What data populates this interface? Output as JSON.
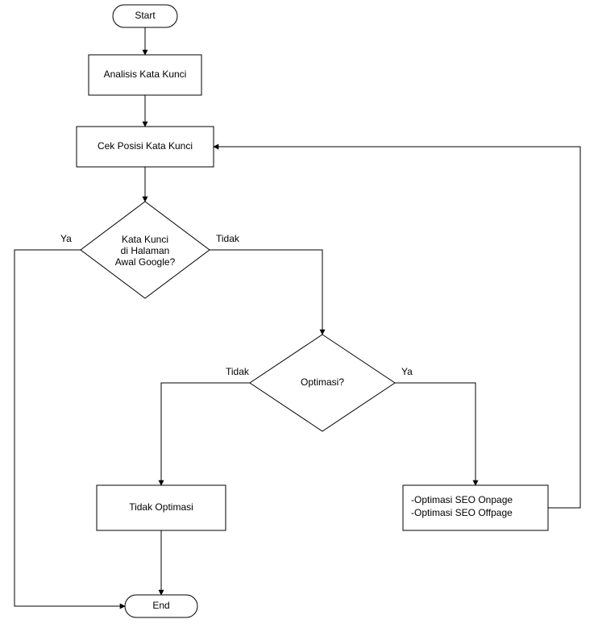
{
  "flowchart": {
    "start": "Start",
    "analyze": "Analisis Kata Kunci",
    "check": "Cek Posisi Kata Kunci",
    "cond1_l1": "Kata Kunci",
    "cond1_l2": "di Halaman",
    "cond1_l3": "Awal Google?",
    "cond1_yes": "Ya",
    "cond1_no": "Tidak",
    "cond2": "Optimasi?",
    "cond2_yes": "Ya",
    "cond2_no": "Tidak",
    "no_opt": "Tidak Optimasi",
    "opt_l1": "-Optimasi SEO Onpage",
    "opt_l2": "-Optimasi SEO Offpage",
    "end": "End"
  },
  "chart_data": {
    "type": "flowchart",
    "nodes": [
      {
        "id": "start",
        "kind": "terminator",
        "label": "Start"
      },
      {
        "id": "analyze",
        "kind": "process",
        "label": "Analisis Kata Kunci"
      },
      {
        "id": "check",
        "kind": "process",
        "label": "Cek Posisi Kata Kunci"
      },
      {
        "id": "cond1",
        "kind": "decision",
        "label": "Kata Kunci di Halaman Awal Google?"
      },
      {
        "id": "cond2",
        "kind": "decision",
        "label": "Optimasi?"
      },
      {
        "id": "noopt",
        "kind": "process",
        "label": "Tidak Optimasi"
      },
      {
        "id": "opt",
        "kind": "process",
        "label": "-Optimasi SEO Onpage\n-Optimasi SEO Offpage"
      },
      {
        "id": "end",
        "kind": "terminator",
        "label": "End"
      }
    ],
    "edges": [
      {
        "from": "start",
        "to": "analyze",
        "label": ""
      },
      {
        "from": "analyze",
        "to": "check",
        "label": ""
      },
      {
        "from": "check",
        "to": "cond1",
        "label": ""
      },
      {
        "from": "cond1",
        "to": "end",
        "label": "Ya"
      },
      {
        "from": "cond1",
        "to": "cond2",
        "label": "Tidak"
      },
      {
        "from": "cond2",
        "to": "noopt",
        "label": "Tidak"
      },
      {
        "from": "cond2",
        "to": "opt",
        "label": "Ya"
      },
      {
        "from": "noopt",
        "to": "end",
        "label": ""
      },
      {
        "from": "opt",
        "to": "check",
        "label": ""
      }
    ]
  }
}
